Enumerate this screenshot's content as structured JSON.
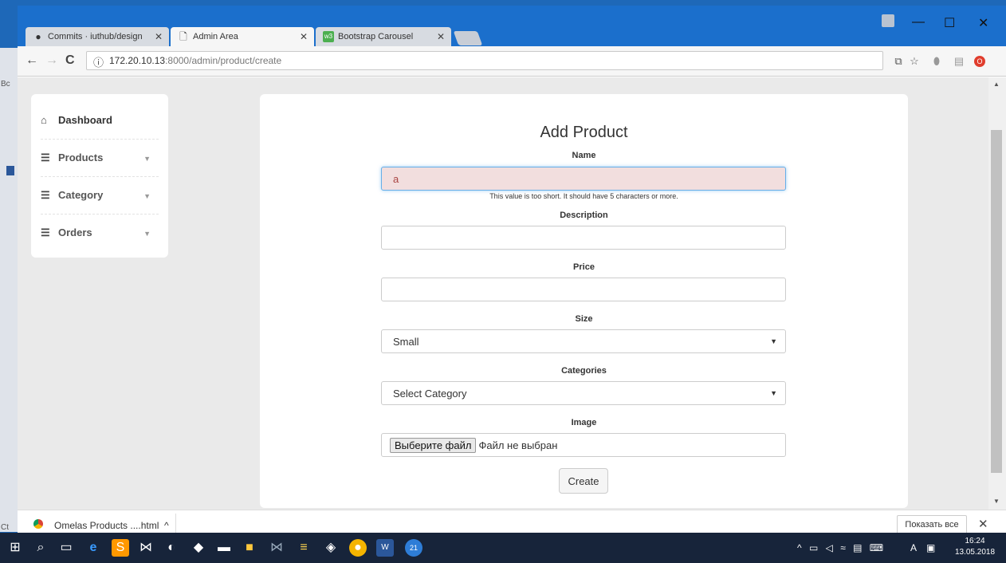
{
  "browser": {
    "tabs": [
      {
        "label": "Commits · iuthub/design",
        "icon": "github-icon"
      },
      {
        "label": "Admin Area",
        "icon": "page-icon"
      },
      {
        "label": "Bootstrap Carousel",
        "icon": "w3schools-icon"
      }
    ],
    "window_controls": {
      "minimize": "—",
      "maximize": "☐",
      "close": "✕"
    },
    "url_host": "172.20.10.13",
    "url_rest": ":8000/admin/product/create"
  },
  "sidebar": {
    "items": [
      {
        "label": "Dashboard",
        "icon": "home-icon",
        "has_caret": false
      },
      {
        "label": "Products",
        "icon": "list-icon",
        "has_caret": true
      },
      {
        "label": "Category",
        "icon": "list-icon",
        "has_caret": true
      },
      {
        "label": "Orders",
        "icon": "list-icon",
        "has_caret": true
      }
    ]
  },
  "form": {
    "title": "Add Product",
    "name_label": "Name",
    "name_value": "a",
    "name_error": "This value is too short. It should have 5 characters or more.",
    "description_label": "Description",
    "description_value": "",
    "price_label": "Price",
    "price_value": "",
    "size_label": "Size",
    "size_selected": "Small",
    "categories_label": "Categories",
    "categories_selected": "Select Category",
    "image_label": "Image",
    "file_button": "Выберите файл",
    "file_status": "Файл не выбран",
    "submit_label": "Create"
  },
  "downloads": {
    "file_name": "Omelas Products ....html",
    "show_all": "Показать все"
  },
  "desktop": {
    "left_text_a": "Bc",
    "left_text_c": "Ct"
  },
  "taskbar": {
    "time": "16:24",
    "date": "13.05.2018",
    "lang": "A",
    "chrome_badge": "21"
  },
  "colors": {
    "titlebar": "#1b6fcc",
    "error_bg": "#f2dede",
    "error_text": "#a94442",
    "focus_border": "#66afe9"
  }
}
